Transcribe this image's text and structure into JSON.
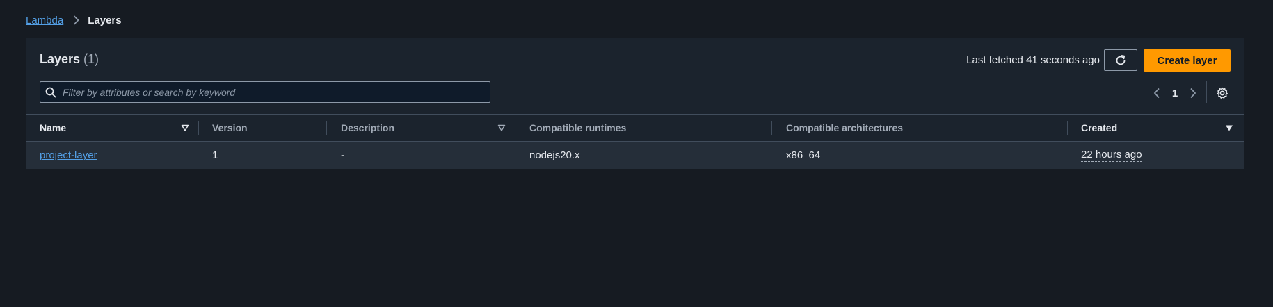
{
  "breadcrumb": {
    "parent": "Lambda",
    "current": "Layers"
  },
  "panel": {
    "title": "Layers",
    "count": "(1)",
    "last_fetched_prefix": "Last fetched",
    "last_fetched_ago": "41 seconds ago",
    "create_label": "Create layer"
  },
  "search": {
    "placeholder": "Filter by attributes or search by keyword",
    "value": ""
  },
  "pagination": {
    "current_page": "1"
  },
  "table": {
    "columns": {
      "name": "Name",
      "version": "Version",
      "description": "Description",
      "runtimes": "Compatible runtimes",
      "architectures": "Compatible architectures",
      "created": "Created"
    },
    "rows": [
      {
        "name": "project-layer",
        "version": "1",
        "description": "-",
        "runtimes": "nodejs20.x",
        "architectures": "x86_64",
        "created": "22 hours ago"
      }
    ]
  },
  "colors": {
    "background": "#161b22",
    "panel": "#1b232d",
    "row": "#252e39",
    "link": "#539fe5",
    "primary": "#ff9900"
  }
}
